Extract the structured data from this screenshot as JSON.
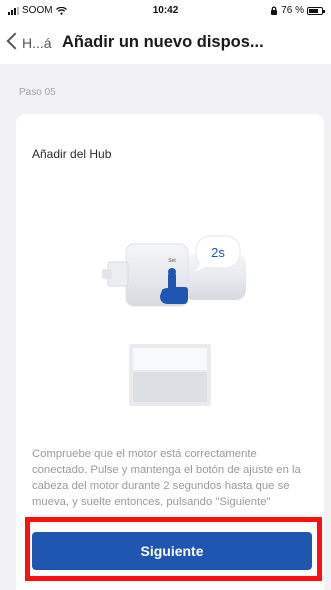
{
  "status_bar": {
    "carrier": "SOOM",
    "time": "10:42",
    "battery_percent": "76 %",
    "battery_level": 0.76
  },
  "nav": {
    "back_label": "H...á",
    "title": "Añadir un nuevo dispos..."
  },
  "step_label": "Paso 05",
  "card": {
    "title": "Añadir del Hub",
    "illustration": {
      "button_label": "Set",
      "hold_time": "2s"
    },
    "instructions": "Compruebe que el motor está correctamente conectado. Pulse y mantenga el botón de ajuste en la cabeza del motor durante 2 segundos hasta que se mueva, y suelte entonces, pulsando \"Siguiente\"",
    "next_button_label": "Siguiente"
  },
  "colors": {
    "primary": "#1e56b2",
    "highlight": "#ff1010",
    "background": "#f2f2f4"
  }
}
